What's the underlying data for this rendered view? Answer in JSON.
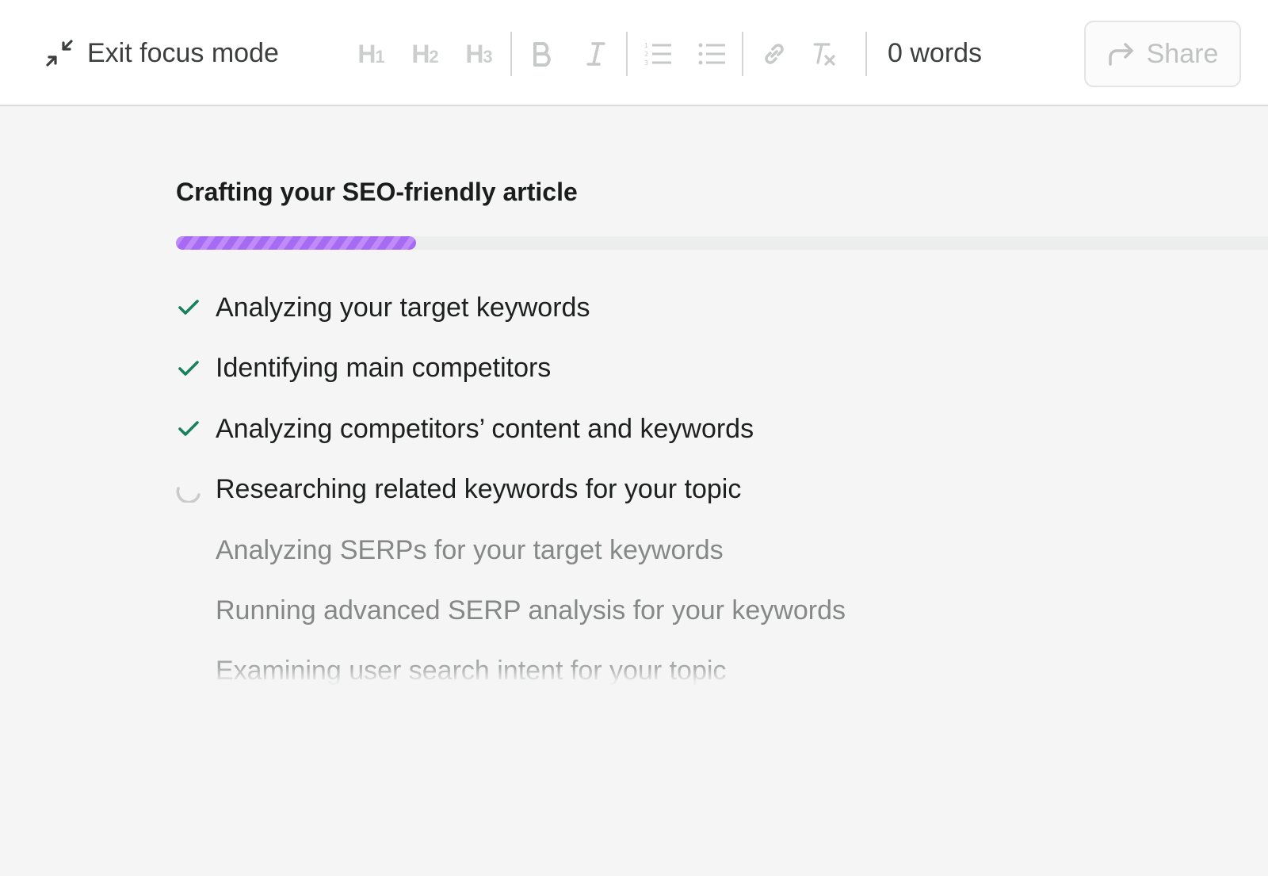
{
  "toolbar": {
    "exit_label": "Exit focus mode",
    "heading_buttons": [
      {
        "text": "H",
        "sub": "1"
      },
      {
        "text": "H",
        "sub": "2"
      },
      {
        "text": "H",
        "sub": "3"
      }
    ],
    "word_count": "0 words",
    "share_label": "Share"
  },
  "main": {
    "title": "Crafting your SEO-friendly article",
    "progress": 0.22,
    "steps": [
      {
        "label": "Analyzing your target keywords",
        "status": "done"
      },
      {
        "label": "Identifying main competitors",
        "status": "done"
      },
      {
        "label": "Analyzing competitors’ content and keywords",
        "status": "done"
      },
      {
        "label": "Researching related keywords for your topic",
        "status": "in-progress"
      },
      {
        "label": "Analyzing SERPs for your target keywords",
        "status": "pending"
      },
      {
        "label": "Running advanced SERP analysis for your keywords",
        "status": "pending"
      },
      {
        "label": "Examining user search intent for your topic",
        "status": "pending"
      }
    ]
  },
  "colors": {
    "accent_purple": "#a66bf2",
    "check_green": "#1a7f5e",
    "spinner_gray": "#c9cccb"
  }
}
